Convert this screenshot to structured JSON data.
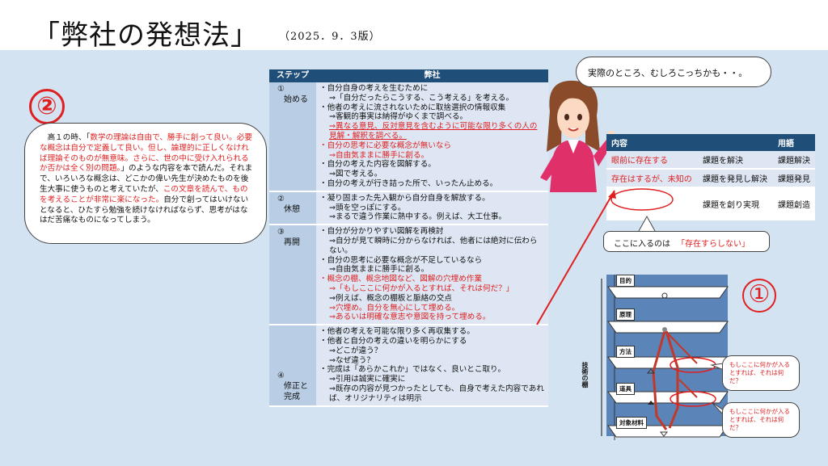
{
  "header": {
    "title": "「弊社の発想法」",
    "subtitle": "（2025．9．3版）"
  },
  "left": {
    "number": "②",
    "text_parts": [
      {
        "t": "　高１の時、「",
        "red": false
      },
      {
        "t": "数学の理論は自由で、勝手に創って良い。必要な概念は自分で定義して良い。但し、論理的に正しくなければ理論そのものが無意味。さらに、世の中に受け入れられるか否かは全く別の問題。",
        "red": true
      },
      {
        "t": "」のような内容を本で読んだ。それまで、いろいろな概念は、どこかの偉い先生が決めたものを後生大事に使うものと考えていたが、",
        "red": false
      },
      {
        "t": "この文章を読んで、ものを考えることが非常に楽になった。",
        "red": true
      },
      {
        "t": "自分で創ってはいけないとなると、ひたすら勉強を続けなければならず、思考がはなはだ苦痛なものになってしまう。",
        "red": false
      }
    ]
  },
  "table": {
    "headers": [
      "ステップ",
      "弊社"
    ],
    "rows": [
      {
        "step_no": "①",
        "step_name": "始める",
        "lines": [
          {
            "t": "・自分自身の考えを生むために",
            "cls": ""
          },
          {
            "t": "⇒「自分だったらこうする、こう考える」を考える。",
            "cls": "ind"
          },
          {
            "t": "・他者の考えに流されないために取捨選択の情報収集",
            "cls": ""
          },
          {
            "t": "⇒客観的事実は納得がゆくまで調べる。",
            "cls": "ind"
          },
          {
            "t": "⇒異なる意見、反対意見を含むように可能な限り多くの人の見解・解釈を調べる。",
            "cls": "ind red ul"
          },
          {
            "t": "・自分の思考に必要な概念が無いなら",
            "cls": "red"
          },
          {
            "t": "⇒自由気ままに勝手に創る。",
            "cls": "ind red"
          },
          {
            "t": "・自分の考えた内容を図解する。",
            "cls": ""
          },
          {
            "t": "⇒図で考える。",
            "cls": "ind"
          },
          {
            "t": "・自分の考えが行き詰った所で、いったん止める。",
            "cls": ""
          }
        ]
      },
      {
        "step_no": "②",
        "step_name": "休憩",
        "lines": [
          {
            "t": "・凝り固まった先入観から自分自身を解放する。",
            "cls": ""
          },
          {
            "t": "⇒頭を空っぽにする。",
            "cls": "ind"
          },
          {
            "t": "⇒まるで違う作業に熱中する。例えば、大工仕事。",
            "cls": "ind"
          }
        ]
      },
      {
        "step_no": "③",
        "step_name": "再開",
        "lines": [
          {
            "t": "・自分が分かりやすい図解を再検討",
            "cls": ""
          },
          {
            "t": "⇒自分が見て瞬時に分からなければ、他者には絶対に伝わらない。",
            "cls": "ind"
          },
          {
            "t": "・自分の思考に必要な概念が不足しているなら",
            "cls": ""
          },
          {
            "t": "⇒自由気ままに勝手に創る。",
            "cls": "ind"
          },
          {
            "t": "・概念の棚、概念地図など、図解の穴埋め作業",
            "cls": "red"
          },
          {
            "t": "⇒「もしここに何かが入るとすれば、それは何だ？」",
            "cls": "ind red"
          },
          {
            "t": "⇒例えば、概念の棚板と脈絡の交点",
            "cls": "ind"
          },
          {
            "t": "⇒穴埋め。自分を無心にして埋める。",
            "cls": "ind red"
          },
          {
            "t": "⇒あるいは明確な意志や意図を持って埋める。",
            "cls": "ind red"
          }
        ]
      },
      {
        "step_no": "④",
        "step_name": "修正と完成",
        "lines": [
          {
            "t": "・他者の考えを可能な限り多く再収集する。",
            "cls": ""
          },
          {
            "t": "・他者と自分の考えの違いを明らかにする",
            "cls": ""
          },
          {
            "t": "⇒どこが違う？",
            "cls": "ind"
          },
          {
            "t": "⇒なぜ違う？",
            "cls": "ind"
          },
          {
            "t": "・完成は「あらかこれか」ではなく、良いとこ取り。",
            "cls": ""
          },
          {
            "t": "⇒引用は誠実に確実に",
            "cls": "ind"
          },
          {
            "t": "⇒既存の内容が見つかったとしても、自身で考えた内容であれば、オリジナリティは明示",
            "cls": "ind"
          }
        ]
      }
    ]
  },
  "speech_top": "実際のところ、むしろこっちかも・・。",
  "concept_table": {
    "headers": [
      "内容",
      "",
      "用語"
    ],
    "rows": [
      {
        "a": "眼前に存在する",
        "a_red": true,
        "b": "課題を解決",
        "term": "課題解決"
      },
      {
        "a": "存在はするが、未知の",
        "a_red": true,
        "b": "課題を発見し解決",
        "term": "課題発見"
      },
      {
        "a": "",
        "a_red": false,
        "b": "課題を創り実現",
        "term": "課題創造"
      }
    ]
  },
  "speech_mid": {
    "prefix": "ここに入るのは",
    "highlight": "「存在すらしない」"
  },
  "diagram": {
    "number": "①",
    "shelves": [
      "目的",
      "原理",
      "方法",
      "道具",
      "対象材料"
    ],
    "side_label": "技術の棚",
    "q1": "もしここに何かが入るとすれば、それは何だ？",
    "q2": "もしここに何かが入るとすれば、それは何だ？",
    "colors": {
      "accent": "#e02020",
      "header": "#1f4e79",
      "panel": "#5b84b8"
    }
  }
}
